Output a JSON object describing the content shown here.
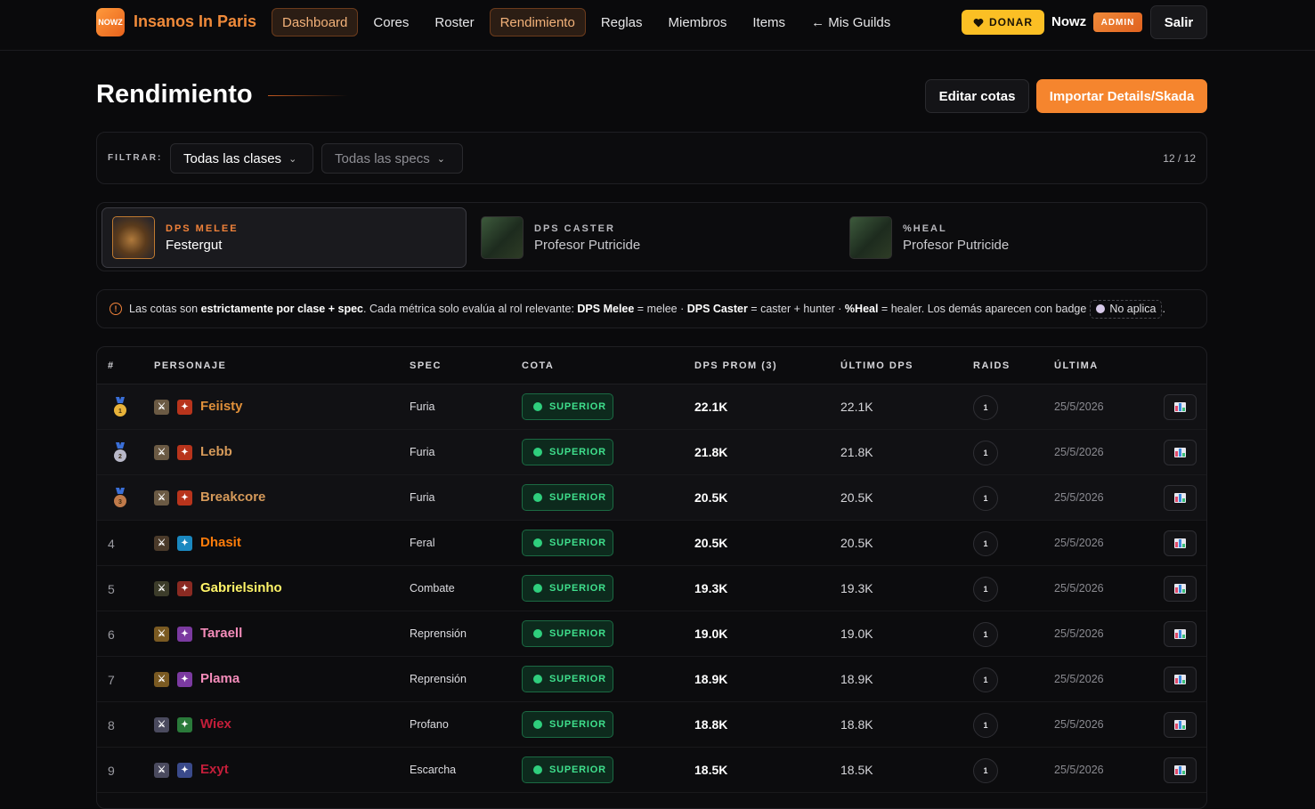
{
  "app": {
    "logo_text": "NOWZ",
    "brand": "Insanos In Paris"
  },
  "nav": [
    {
      "label": "Dashboard",
      "active": true
    },
    {
      "label": "Cores",
      "active": false
    },
    {
      "label": "Roster",
      "active": false
    },
    {
      "label": "Rendimiento",
      "active": true
    },
    {
      "label": "Reglas",
      "active": false
    },
    {
      "label": "Miembros",
      "active": false
    },
    {
      "label": "Items",
      "active": false
    },
    {
      "label": "← Mis Guilds",
      "active": false
    }
  ],
  "user": {
    "donate_label": "DONAR",
    "name": "Nowz",
    "role_badge": "ADMIN",
    "logout_label": "Salir"
  },
  "page": {
    "title": "Rendimiento",
    "edit_label": "Editar cotas",
    "import_label": "Importar Details/Skada"
  },
  "filters": {
    "label": "FILTRAR:",
    "class_select": "Todas las clases",
    "spec_select": "Todas las specs",
    "count": "12 / 12"
  },
  "bosses": [
    {
      "role": "DPS MELEE",
      "name": "Festergut",
      "active": true
    },
    {
      "role": "DPS CASTER",
      "name": "Profesor Putricide",
      "active": false
    },
    {
      "role": "%HEAL",
      "name": "Profesor Putricide",
      "active": false
    }
  ],
  "info": {
    "p1": "Las cotas son ",
    "b1": "estrictamente por clase + spec",
    "p2": ". Cada métrica solo evalúa al rol relevante: ",
    "b2": "DPS Melee",
    "p3": " = melee · ",
    "b3": "DPS Caster",
    "p4": " = caster + hunter · ",
    "b4": "%Heal",
    "p5": " = healer. Los demás aparecen con badge ",
    "chip": "No aplica",
    "p6": "."
  },
  "table": {
    "headers": [
      "#",
      "PERSONAJE",
      "SPEC",
      "COTA",
      "DPS PROM (3)",
      "ÚLTIMO DPS",
      "RAIDS",
      "ÚLTIMA"
    ],
    "rows": [
      {
        "rank": "1",
        "medal": "gold",
        "name": "Feiisty",
        "name_color": "#e0903a",
        "spec": "Furia",
        "cota": "SUPERIOR",
        "dps_avg": "22.1K",
        "dps_last": "22.1K",
        "raids": "1",
        "date": "25/5/2026",
        "icon1": "warrior",
        "icon2": "fury"
      },
      {
        "rank": "2",
        "medal": "silver",
        "name": "Lebb",
        "name_color": "#d69a5a",
        "spec": "Furia",
        "cota": "SUPERIOR",
        "dps_avg": "21.8K",
        "dps_last": "21.8K",
        "raids": "1",
        "date": "25/5/2026",
        "icon1": "warrior",
        "icon2": "fury"
      },
      {
        "rank": "3",
        "medal": "bronze",
        "name": "Breakcore",
        "name_color": "#d69a5a",
        "spec": "Furia",
        "cota": "SUPERIOR",
        "dps_avg": "20.5K",
        "dps_last": "20.5K",
        "raids": "1",
        "date": "25/5/2026",
        "icon1": "warrior",
        "icon2": "fury"
      },
      {
        "rank": "4",
        "medal": "",
        "name": "Dhasit",
        "name_color": "#ff7c0a",
        "spec": "Feral",
        "cota": "SUPERIOR",
        "dps_avg": "20.5K",
        "dps_last": "20.5K",
        "raids": "1",
        "date": "25/5/2026",
        "icon1": "druid",
        "icon2": "feral"
      },
      {
        "rank": "5",
        "medal": "",
        "name": "Gabrielsinho",
        "name_color": "#fff468",
        "spec": "Combate",
        "cota": "SUPERIOR",
        "dps_avg": "19.3K",
        "dps_last": "19.3K",
        "raids": "1",
        "date": "25/5/2026",
        "icon1": "rogue",
        "icon2": "combat"
      },
      {
        "rank": "6",
        "medal": "",
        "name": "Taraell",
        "name_color": "#f48cba",
        "spec": "Reprensión",
        "cota": "SUPERIOR",
        "dps_avg": "19.0K",
        "dps_last": "19.0K",
        "raids": "1",
        "date": "25/5/2026",
        "icon1": "paladin",
        "icon2": "retribution"
      },
      {
        "rank": "7",
        "medal": "",
        "name": "Plama",
        "name_color": "#f48cba",
        "spec": "Reprensión",
        "cota": "SUPERIOR",
        "dps_avg": "18.9K",
        "dps_last": "18.9K",
        "raids": "1",
        "date": "25/5/2026",
        "icon1": "paladin",
        "icon2": "retribution"
      },
      {
        "rank": "8",
        "medal": "",
        "name": "Wiex",
        "name_color": "#c41e3a",
        "spec": "Profano",
        "cota": "SUPERIOR",
        "dps_avg": "18.8K",
        "dps_last": "18.8K",
        "raids": "1",
        "date": "25/5/2026",
        "icon1": "death-knight",
        "icon2": "unholy"
      },
      {
        "rank": "9",
        "medal": "",
        "name": "Exyt",
        "name_color": "#c41e3a",
        "spec": "Escarcha",
        "cota": "SUPERIOR",
        "dps_avg": "18.5K",
        "dps_last": "18.5K",
        "raids": "1",
        "date": "25/5/2026",
        "icon1": "death-knight",
        "icon2": "frost"
      }
    ]
  }
}
